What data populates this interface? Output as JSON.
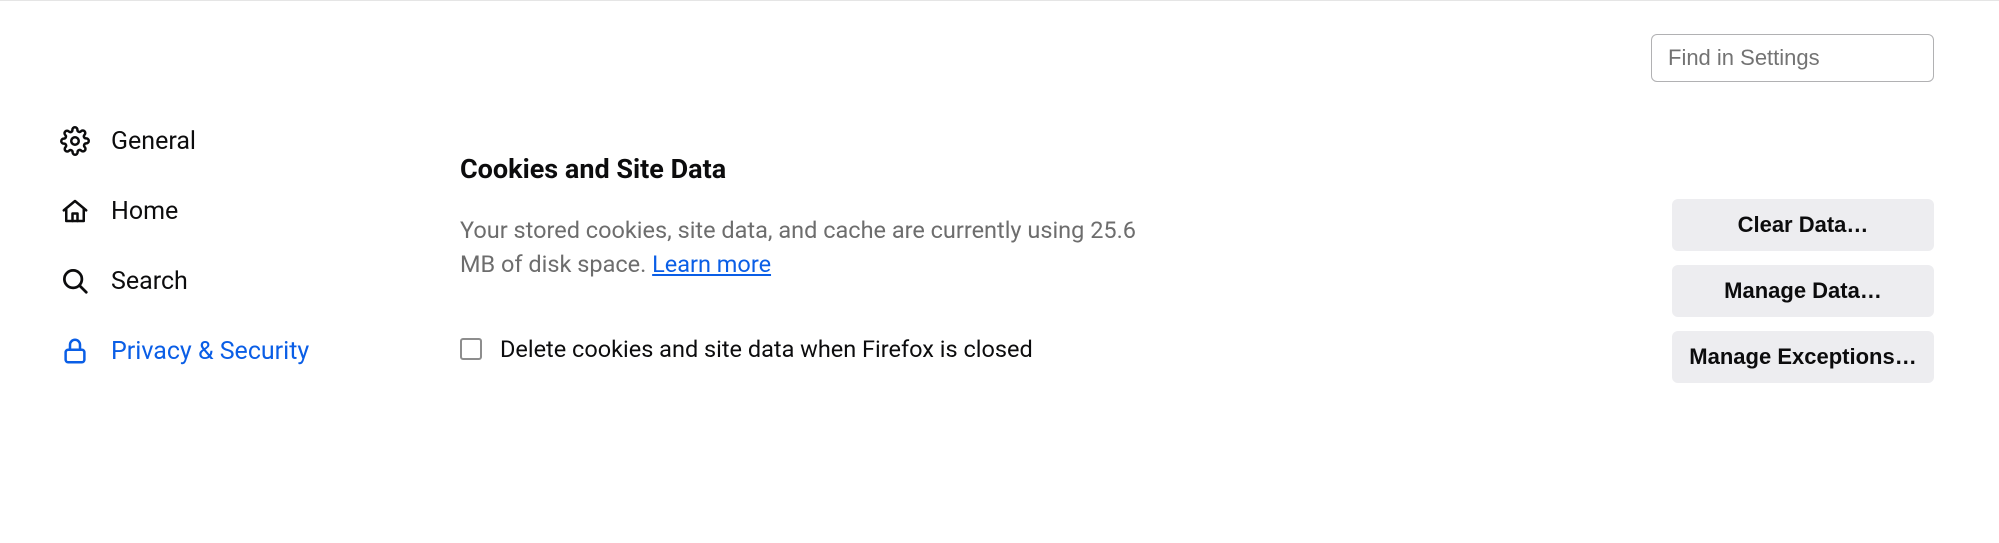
{
  "search": {
    "placeholder": "Find in Settings"
  },
  "sidebar": {
    "items": [
      {
        "label": "General"
      },
      {
        "label": "Home"
      },
      {
        "label": "Search"
      },
      {
        "label": "Privacy & Security"
      }
    ]
  },
  "main": {
    "section_title": "Cookies and Site Data",
    "desc_prefix": "Your stored cookies, site data, and cache are currently using ",
    "usage": "25.6 MB",
    "desc_suffix": " of disk space. ",
    "learn_more": "Learn more",
    "checkbox_label": "Delete cookies and site data when Firefox is closed"
  },
  "actions": {
    "clear_data": "Clear Data…",
    "manage_data": "Manage Data…",
    "manage_exceptions": "Manage Exceptions…"
  }
}
